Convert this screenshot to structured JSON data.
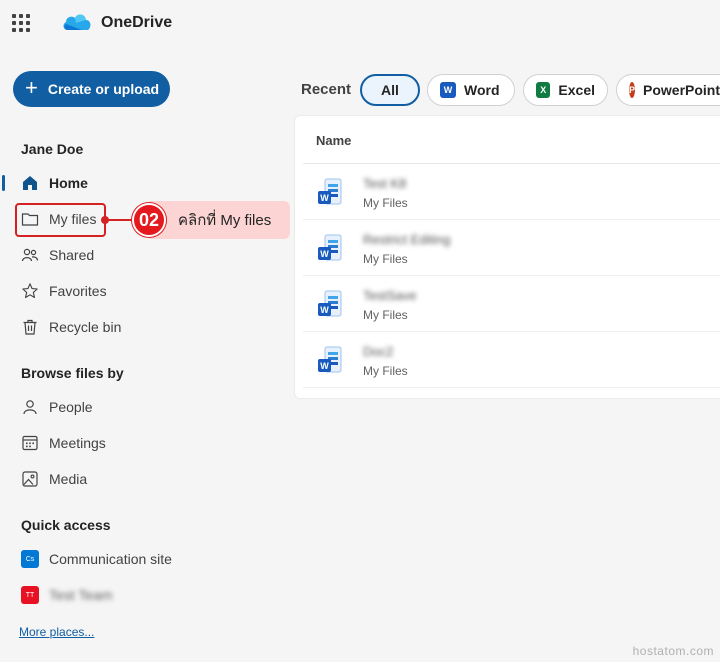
{
  "header": {
    "app_name": "OneDrive"
  },
  "create_button": {
    "label": "Create or upload"
  },
  "sidebar": {
    "user_name": "Jane Doe",
    "items": [
      {
        "label": "Home",
        "icon": "home-icon"
      },
      {
        "label": "My files",
        "icon": "folder-icon"
      },
      {
        "label": "Shared",
        "icon": "people-icon"
      },
      {
        "label": "Favorites",
        "icon": "star-icon"
      },
      {
        "label": "Recycle bin",
        "icon": "trash-icon"
      }
    ],
    "browse_heading": "Browse files by",
    "browse_items": [
      {
        "label": "People",
        "icon": "person-icon"
      },
      {
        "label": "Meetings",
        "icon": "calendar-icon"
      },
      {
        "label": "Media",
        "icon": "image-icon"
      }
    ],
    "quick_access_heading": "Quick access",
    "quick_access": [
      {
        "badge": "Cs",
        "label": "Communication site",
        "color": "#0078d4"
      },
      {
        "badge": "TT",
        "label": "Test Team",
        "color": "#d13438"
      }
    ],
    "more_places": "More places..."
  },
  "annotation": {
    "step": "02",
    "text": "คลิกที่ My files",
    "color": "#e3191d"
  },
  "filters": {
    "recent_label": "Recent",
    "pills": [
      {
        "label": "All",
        "selected": true
      },
      {
        "label": "Word",
        "icon": "word-icon",
        "color": "#185abd"
      },
      {
        "label": "Excel",
        "icon": "excel-icon",
        "color": "#107c41"
      },
      {
        "label": "PowerPoint",
        "icon": "powerpoint-icon",
        "color": "#c43e1c"
      }
    ]
  },
  "files": {
    "column_name": "Name",
    "rows": [
      {
        "name": "Test K8",
        "location": "My Files"
      },
      {
        "name": "Restrict Editing",
        "location": "My Files"
      },
      {
        "name": "TestSave",
        "location": "My Files"
      },
      {
        "name": "Doc2",
        "location": "My Files"
      }
    ]
  },
  "watermark": "hostatom.com"
}
